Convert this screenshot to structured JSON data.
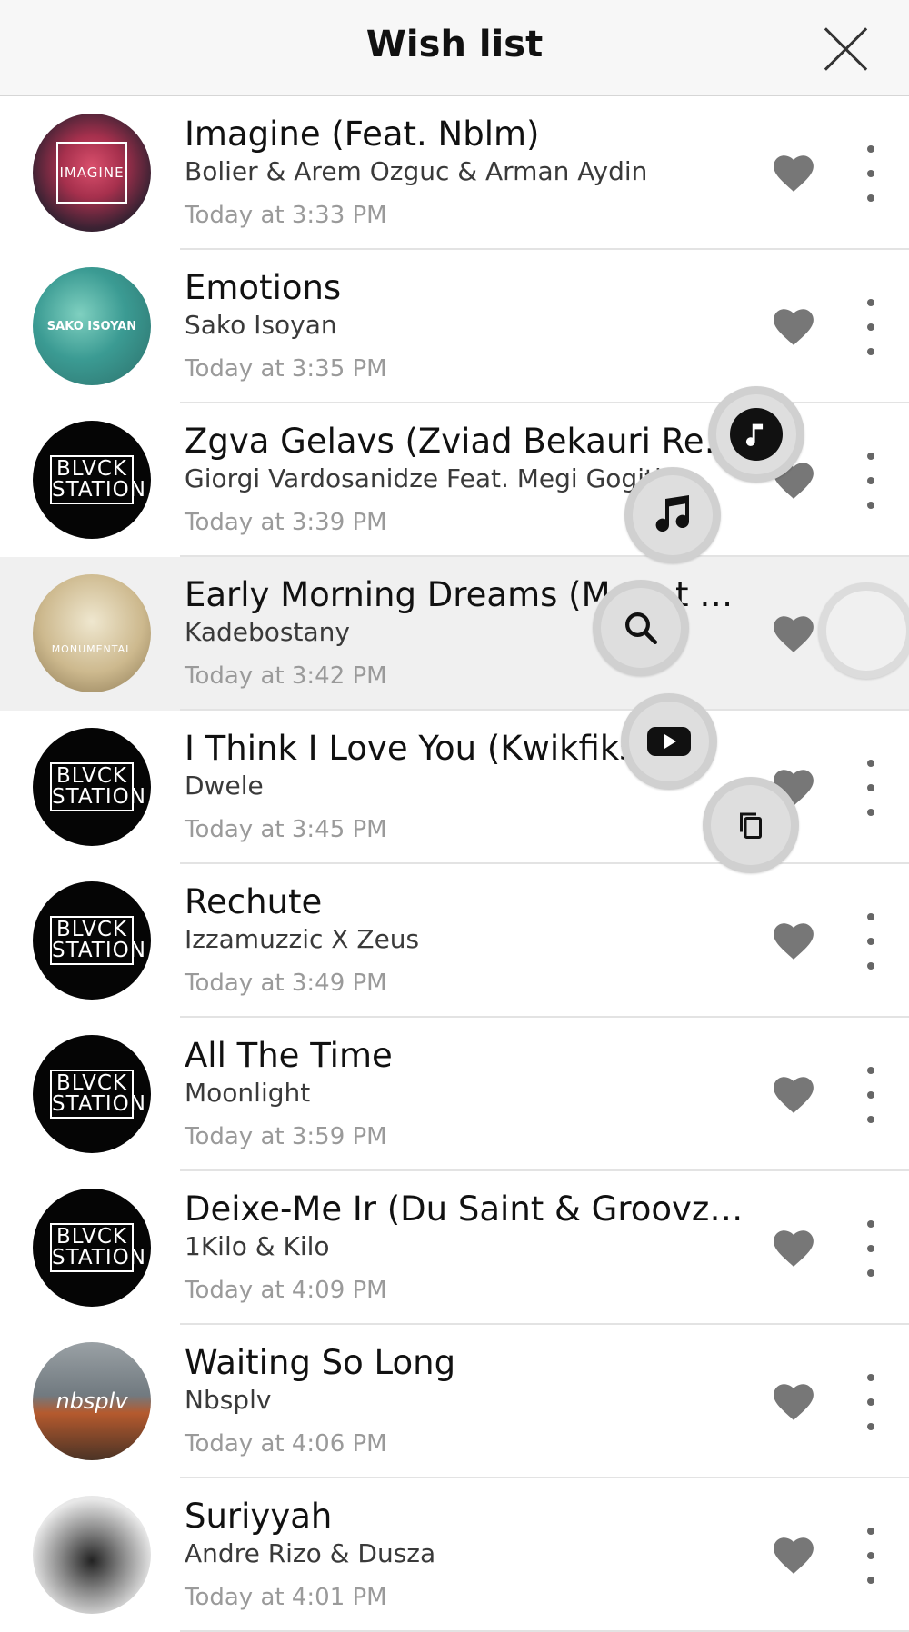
{
  "header": {
    "title": "Wish list"
  },
  "songs": [
    {
      "title": "Imagine (Feat. Nblm)",
      "artist": "Bolier & Arem Ozguc & Arman Aydin",
      "time": "Today at 3:33 PM",
      "art": "imagine",
      "art_text": "IMAGINE"
    },
    {
      "title": "Emotions",
      "artist": "Sako Isoyan",
      "time": "Today at 3:35 PM",
      "art": "sea",
      "art_text": "SAKO ISOYAN"
    },
    {
      "title": "Zgva Gelavs (Zviad Bekauri Remix",
      "artist": "Giorgi Vardosanidze Feat. Megi Gogiti",
      "time": "Today at 3:39 PM",
      "art": "black",
      "art_text": "BLVCK STATION"
    },
    {
      "title": "Early Morning Dreams (Ma… t O…",
      "artist": "Kadebostany",
      "time": "Today at 3:42 PM",
      "art": "mono",
      "art_text": "MONUMENTAL"
    },
    {
      "title": "I Think I Love You (Kwikfiks …",
      "artist": "Dwele",
      "time": "Today at 3:45 PM",
      "art": "black",
      "art_text": "BLVCK STATION"
    },
    {
      "title": "Rechute",
      "artist": "Izzamuzzic X Zeus",
      "time": "Today at 3:49 PM",
      "art": "black",
      "art_text": "BLVCK STATION"
    },
    {
      "title": "All The Time",
      "artist": "Moonlight",
      "time": "Today at 3:59 PM",
      "art": "black",
      "art_text": "BLVCK STATION"
    },
    {
      "title": "Deixe-Me Ir (Du Saint & Groovzer…",
      "artist": "1Kilo & Kilo",
      "time": "Today at 4:09 PM",
      "art": "black",
      "art_text": "BLVCK STATION"
    },
    {
      "title": "Waiting So Long",
      "artist": "Nbsplv",
      "time": "Today at 4:06 PM",
      "art": "beach",
      "art_text": "nbsplv"
    },
    {
      "title": "Suriyyah",
      "artist": "Andre Rizo & Dusza",
      "time": "Today at 4:01 PM",
      "art": "sketch",
      "art_text": ""
    }
  ],
  "colors": {
    "heart": "#777777",
    "active_row": "#f0f0f0",
    "menu_button": "#d0d0d0"
  },
  "radial_menu": {
    "actions": [
      {
        "name": "apple-music-action",
        "icon": "music-note-icon"
      },
      {
        "name": "music-action",
        "icon": "music-note-icon"
      },
      {
        "name": "search-action",
        "icon": "search-icon"
      },
      {
        "name": "youtube-action",
        "icon": "youtube-icon"
      },
      {
        "name": "copy-action",
        "icon": "copy-icon"
      }
    ]
  }
}
